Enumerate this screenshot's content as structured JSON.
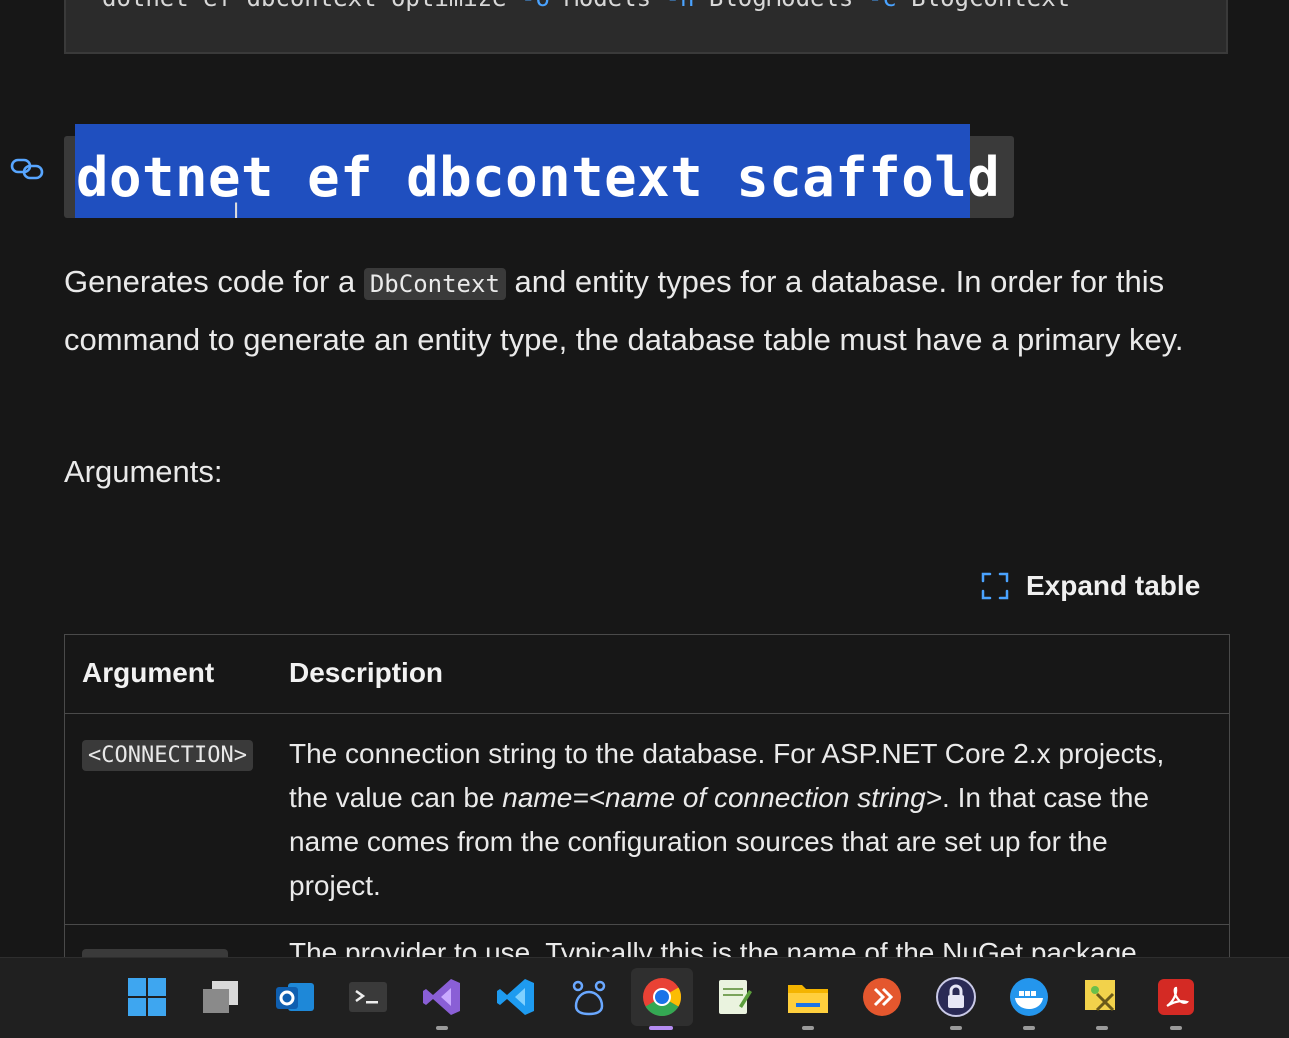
{
  "top_code": {
    "parts": [
      {
        "text": "dotnet ef dbcontext optimize ",
        "kw": false
      },
      {
        "text": "-o",
        "kw": true
      },
      {
        "text": " Models ",
        "kw": false
      },
      {
        "text": "-n",
        "kw": true
      },
      {
        "text": " BlogModels ",
        "kw": false
      },
      {
        "text": "-c",
        "kw": true
      },
      {
        "text": " BlogContext",
        "kw": false
      }
    ]
  },
  "heading": {
    "text": "dotnet ef dbcontext scaffold"
  },
  "paragraph": {
    "part1": "Generates code for a ",
    "code": "DbContext",
    "part2": " and entity types for a database. In order for this command to generate an entity type, the database table must have a primary key."
  },
  "arguments_label": "Arguments:",
  "expand_table_label": "Expand table",
  "table": {
    "headers": [
      "Argument",
      "Description"
    ],
    "row1": {
      "argument": "<CONNECTION>",
      "desc_part1": "The connection string to the database. For ASP.NET Core 2.x projects, the value can be ",
      "desc_italic": "name=<name of connection string>",
      "desc_part2": ". In that case the name comes from the configuration sources that are set up for the project."
    },
    "row2": {
      "desc_partial": "The provider to use. Typically this is the name of the NuGet package"
    }
  },
  "taskbar": {
    "apps": [
      {
        "name": "windows-start-icon",
        "running": false
      },
      {
        "name": "task-view-icon",
        "running": false
      },
      {
        "name": "outlook-icon",
        "running": false
      },
      {
        "name": "terminal-icon",
        "running": false
      },
      {
        "name": "visual-studio-icon",
        "running": true
      },
      {
        "name": "vscode-icon",
        "running": false
      },
      {
        "name": "app-paw-icon",
        "running": false
      },
      {
        "name": "chrome-icon",
        "running": true,
        "active": true
      },
      {
        "name": "notepad-icon",
        "running": false
      },
      {
        "name": "file-explorer-icon",
        "running": true
      },
      {
        "name": "remote-desktop-icon",
        "running": false
      },
      {
        "name": "keepass-icon",
        "running": true
      },
      {
        "name": "docker-icon",
        "running": true
      },
      {
        "name": "snipping-tool-icon",
        "running": true
      },
      {
        "name": "acrobat-icon",
        "running": true
      }
    ]
  },
  "colors": {
    "selection": "#1f4fbf",
    "chrome_indicator": "#b58cf2",
    "background": "#171717"
  }
}
